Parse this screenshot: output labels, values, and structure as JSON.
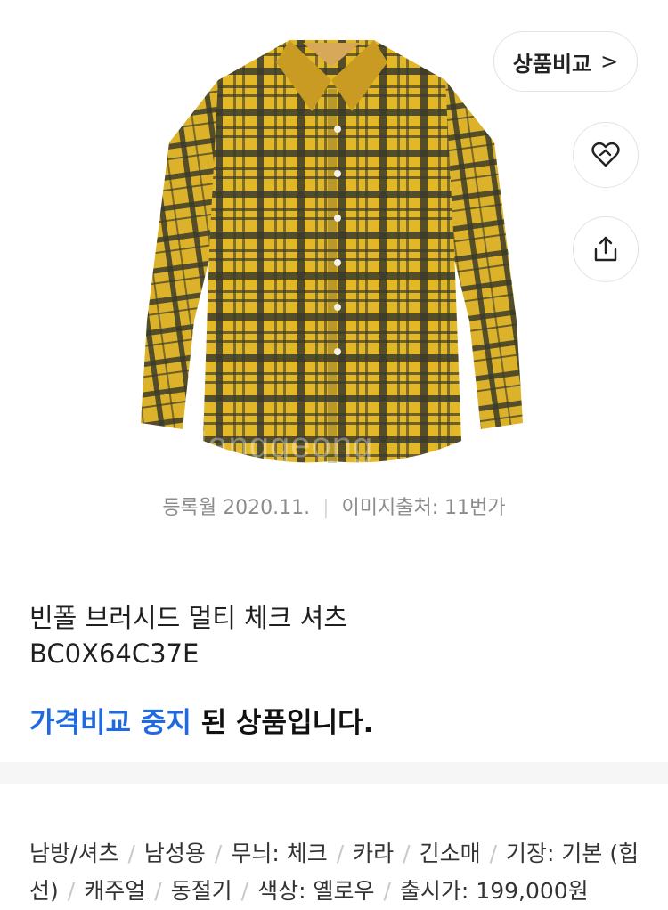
{
  "hero": {
    "watermark": "danggeong"
  },
  "actions": {
    "compare_label": "상품비교",
    "compare_chevron": ">",
    "heart_icon": "heart-icon",
    "share_icon": "share-icon"
  },
  "meta": {
    "registered": "등록월 2020.11.",
    "image_source": "이미지출처: 11번가"
  },
  "product": {
    "name_line1": "빈폴 브러시드 멀티 체크 셔츠",
    "name_line2": "BC0X64C37E",
    "status_highlight": "가격비교 중지",
    "status_rest": " 된 상품입니다."
  },
  "specs": [
    "남방/셔츠",
    "남성용",
    "무늬: 체크",
    "카라",
    "긴소매",
    "기장: 기본 (힙선)",
    "캐주얼",
    "동절기",
    "색상: 옐로우",
    "출시가: 199,000원"
  ],
  "colors": {
    "accent": "#1f6ae0",
    "shirt_yellow": "#e1b52a",
    "shirt_dark": "#3a3a28"
  }
}
